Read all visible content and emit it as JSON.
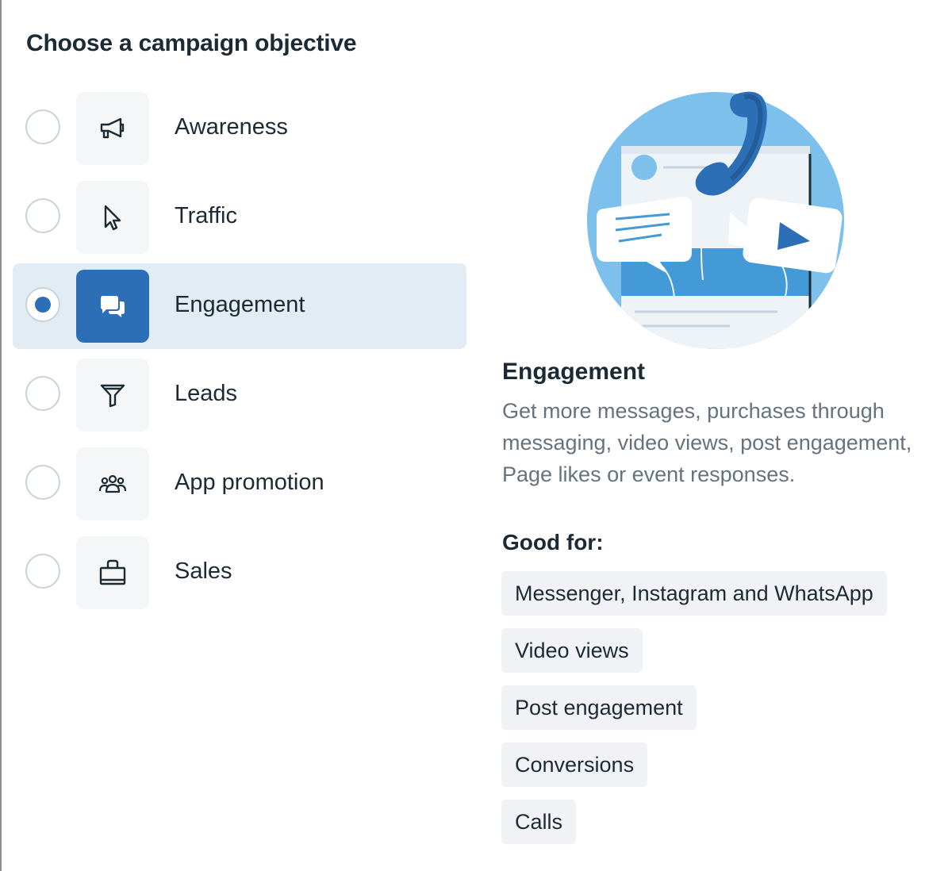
{
  "dialog": {
    "title": "Choose a campaign objective"
  },
  "objectives": [
    {
      "label": "Awareness",
      "icon": "megaphone-icon",
      "selected": false
    },
    {
      "label": "Traffic",
      "icon": "cursor-icon",
      "selected": false
    },
    {
      "label": "Engagement",
      "icon": "chat-bubbles-icon",
      "selected": true
    },
    {
      "label": "Leads",
      "icon": "funnel-icon",
      "selected": false
    },
    {
      "label": "App promotion",
      "icon": "people-icon",
      "selected": false
    },
    {
      "label": "Sales",
      "icon": "shopping-bag-icon",
      "selected": false
    }
  ],
  "details": {
    "title": "Engagement",
    "description": "Get more messages, purchases through messaging, video views, post engagement, Page likes or event responses.",
    "good_for_label": "Good for:",
    "good_for": [
      "Messenger, Instagram and WhatsApp",
      "Video views",
      "Post engagement",
      "Conversions",
      "Calls"
    ]
  },
  "colors": {
    "accent": "#2d6fb7",
    "selected_row_bg": "#e2ecf5",
    "tile_bg": "#f5f6f7",
    "chip_bg": "#f1f2f5",
    "text_primary": "#1c2b33",
    "text_secondary": "#65737e"
  }
}
